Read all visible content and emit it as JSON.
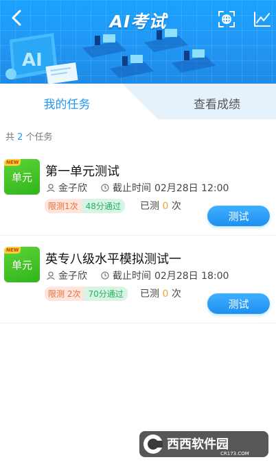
{
  "header": {
    "title": "AI考试",
    "ai_screen_text": "AI",
    "colors": {
      "primary": "#2196f3",
      "banner_top": "#1aa3ff"
    }
  },
  "tabs": [
    {
      "label": "我的任务",
      "active": true
    },
    {
      "label": "查看成绩",
      "active": false
    }
  ],
  "summary": {
    "prefix": "共",
    "count": "2",
    "suffix": "个任务"
  },
  "tasks": [
    {
      "icon_label": "单元",
      "new_tag": "NEW",
      "title": "第一单元测试",
      "person": "金子欣",
      "deadline_label": "截止时间",
      "deadline": "02月28日 12:00",
      "limit": "限测1次",
      "pass": "48分通过",
      "tested_prefix": "已测",
      "tested_count": "0",
      "tested_suffix": "次",
      "button": "测试"
    },
    {
      "icon_label": "单元",
      "new_tag": "NEW",
      "title": "英专八级水平模拟测试一",
      "person": "金子欣",
      "deadline_label": "截止时间",
      "deadline": "02月28日 18:00",
      "limit": "限测 2次",
      "pass": "70分通过",
      "tested_prefix": "已测",
      "tested_count": "0",
      "tested_suffix": "次",
      "button": "测试"
    }
  ],
  "watermark": {
    "text": "西西软件园",
    "subtext": "CR173.COM"
  }
}
